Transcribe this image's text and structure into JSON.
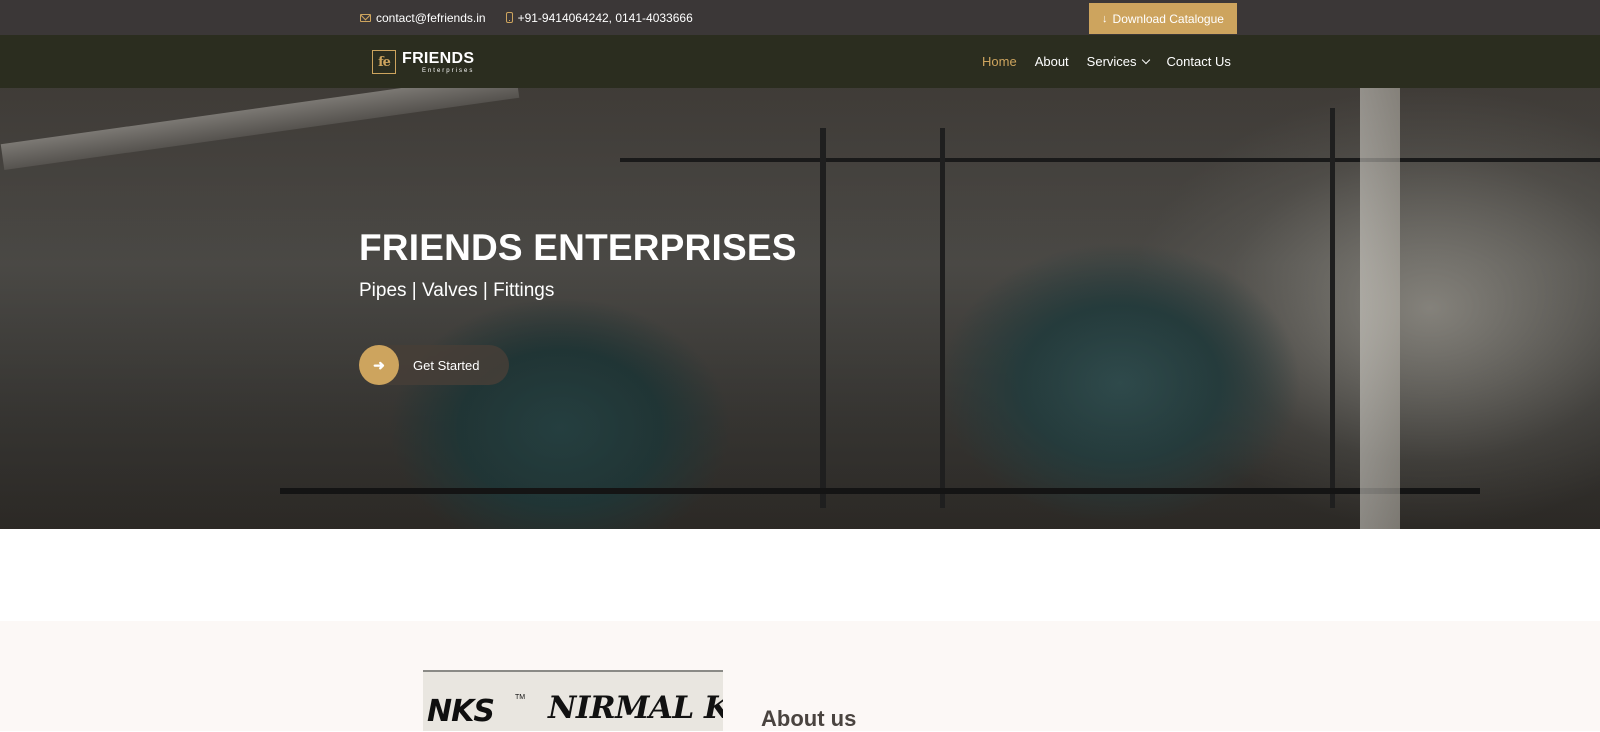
{
  "topbar": {
    "email": "contact@fefriends.in",
    "phone": "+91-9414064242, 0141-4033666",
    "download_label": "Download Catalogue",
    "icons": {
      "email": "envelope-icon",
      "phone": "phone-icon",
      "download": "arrow-down-icon"
    }
  },
  "nav": {
    "logo": {
      "mark": "fe",
      "title": "FRIENDS",
      "subtitle": "Enterprises"
    },
    "items": [
      {
        "label": "Home",
        "active": true
      },
      {
        "label": "About",
        "active": false
      },
      {
        "label": "Services",
        "active": false
      },
      {
        "label": "Contact Us",
        "active": false
      }
    ]
  },
  "hero": {
    "title": "FRIENDS ENTERPRISES",
    "subtitle": "Pipes | Valves | Fittings",
    "cta_label": "Get Started",
    "cta_icon": "arrow-right-icon"
  },
  "about": {
    "image_text_left": "NKS",
    "image_text_tm": "TM",
    "image_text_right": "NIRMAL KUM",
    "heading": "About us"
  },
  "colors": {
    "accent": "#cda45e",
    "topbar": "#3b3737",
    "navbar": "#2b2d1f",
    "section_bg": "#fcf8f6"
  }
}
